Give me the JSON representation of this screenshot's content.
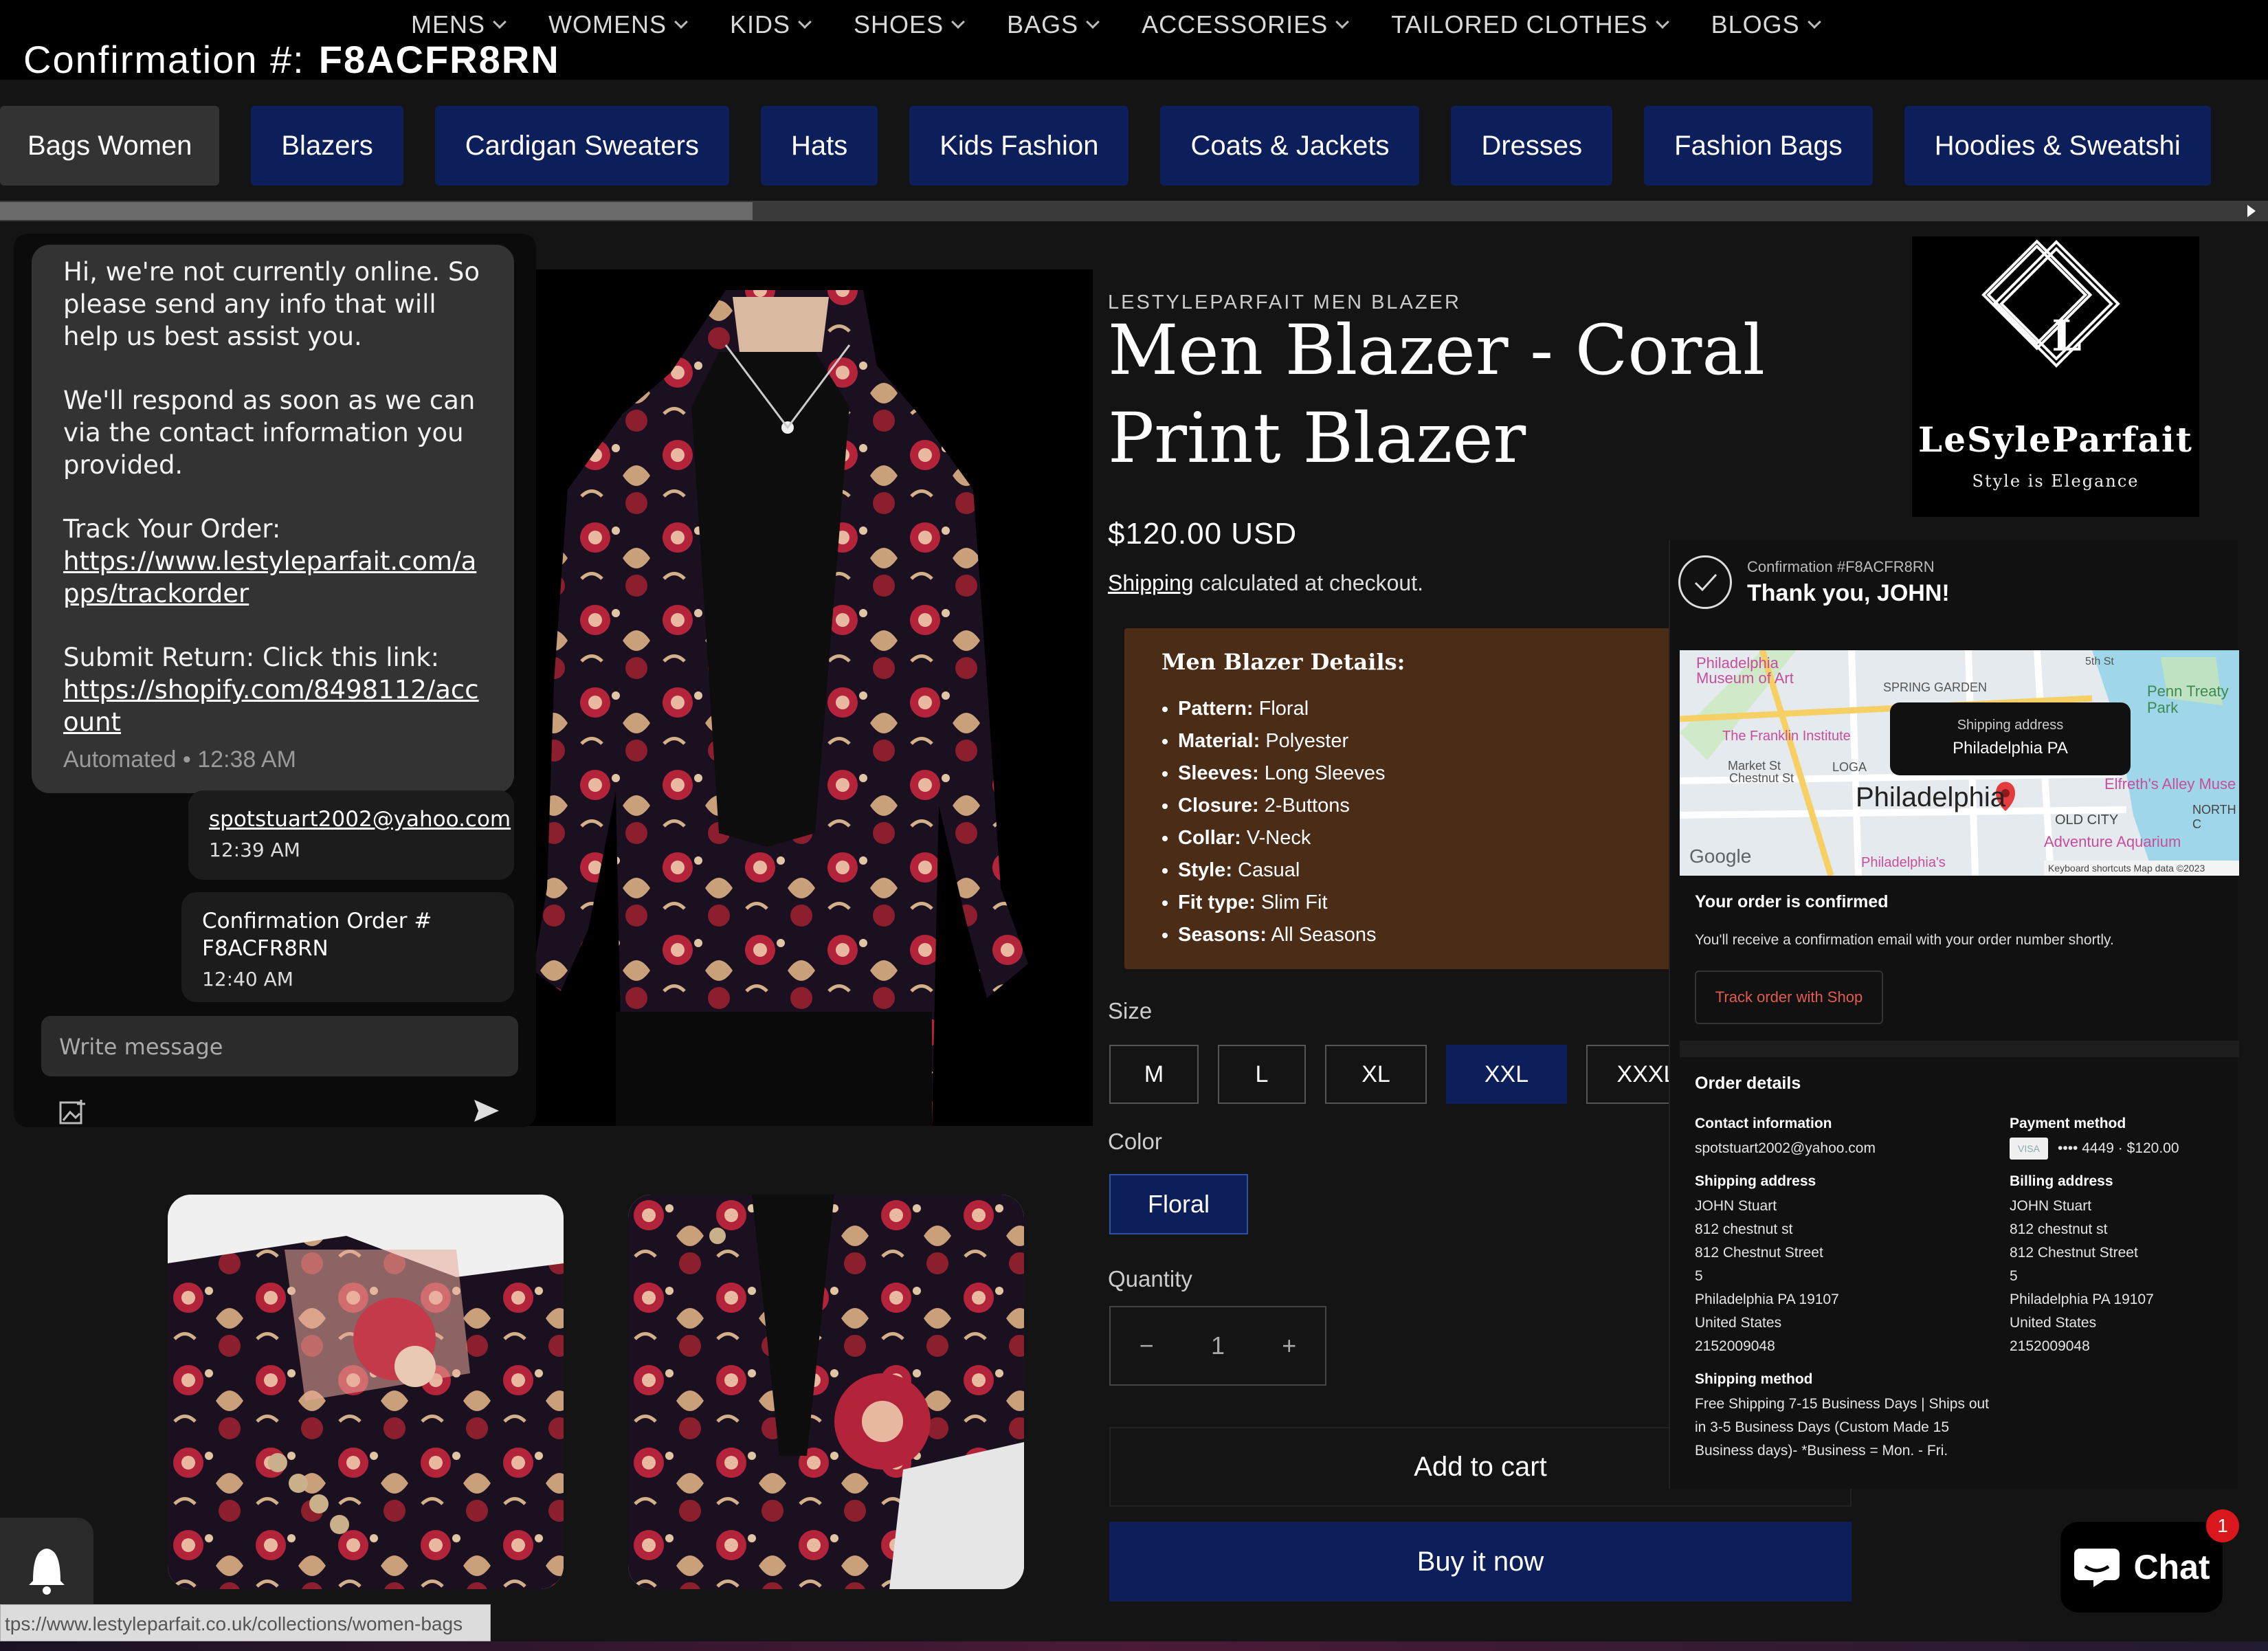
{
  "nav": {
    "items": [
      "MENS",
      "WOMENS",
      "KIDS",
      "SHOES",
      "BAGS",
      "ACCESSORIES",
      "TAILORED CLOTHES",
      "BLOGS"
    ]
  },
  "confirmation_banner": {
    "label": "Confirmation #:",
    "code": "F8ACFR8RN"
  },
  "categories": [
    "Bags Women",
    "Blazers",
    "Cardigan Sweaters",
    "Hats",
    "Kids Fashion",
    "Coats & Jackets",
    "Dresses",
    "Fashion Bags",
    "Hoodies & Sweatshi"
  ],
  "chat": {
    "bot_message": {
      "p1": "Hi, we're not currently online. So please send any info that will help us best assist you.",
      "p2": "We'll respond as soon as we can via the contact information you provided.",
      "p3_label": "Track Your Order:",
      "p3_link": "https://www.lestyleparfait.com/apps/trackorder",
      "p4_label": "Submit Return: Click this link:",
      "p4_link": "https://shopify.com/8498112/account",
      "meta": "Automated • 12:38 AM"
    },
    "user_messages": [
      {
        "text": "spotstuart2002@yahoo.com",
        "time": "12:39 AM"
      },
      {
        "line1": "Confirmation Order #",
        "line2": "F8ACFR8RN",
        "time": "12:40 AM"
      }
    ],
    "input_placeholder": "Write message"
  },
  "product": {
    "vendor": "LESTYLEPARFAIT MEN BLAZER",
    "title": "Men Blazer - Coral Print Blazer",
    "price": "$120.00 USD",
    "shipping_link": "Shipping",
    "shipping_rest": " calculated at checkout.",
    "details_title": "Men Blazer Details:",
    "details": [
      {
        "k": "Pattern:",
        "v": " Floral"
      },
      {
        "k": "Material:",
        "v": " Polyester"
      },
      {
        "k": "Sleeves:",
        "v": " Long Sleeves"
      },
      {
        "k": "Closure:",
        "v": " 2-Buttons"
      },
      {
        "k": "Collar:",
        "v": " V-Neck"
      },
      {
        "k": "Style:",
        "v": " Casual"
      },
      {
        "k": "Fit type:",
        "v": " Slim Fit"
      },
      {
        "k": "Seasons:",
        "v": " All Seasons"
      }
    ],
    "size_label": "Size",
    "sizes": [
      "M",
      "L",
      "XL",
      "XXL",
      "XXXL"
    ],
    "selected_size": "XXL",
    "color_label": "Color",
    "color": "Floral",
    "quantity_label": "Quantity",
    "quantity": "1",
    "minus": "−",
    "plus": "+",
    "add_to_cart": "Add to cart",
    "buy_now": "Buy it now"
  },
  "logo": {
    "name": "LeSyleParfait",
    "tagline": "Style is Elegance",
    "letter": "L"
  },
  "order": {
    "conf_label": "Confirmation #F8ACFR8RN",
    "thanks": "Thank you, JOHN!",
    "map": {
      "shipping_address_label": "Shipping address",
      "city": "Philadelphia PA",
      "labels": [
        "Philadelphia Museum of Art",
        "SPRING GARDEN",
        "The Franklin Institute",
        "Market St",
        "Chestnut St",
        "Philadelphia",
        "OLD CITY",
        "Penn Treaty Park",
        "Elfreth's Alley Muse",
        "Adventure Aquarium",
        "NORTH C",
        "5th St",
        "Google",
        "Keyboard shortcuts",
        "Map data ©2023",
        "LOGA",
        "Philadelphia's"
      ]
    },
    "confirmed_title": "Your order is confirmed",
    "confirmed_msg": "You'll receive a confirmation email with your order number shortly.",
    "track_btn": "Track order with Shop",
    "details_title": "Order details",
    "contact_label": "Contact information",
    "contact": "spotstuart2002@yahoo.com",
    "shipping_label": "Shipping address",
    "shipping_lines": [
      "JOHN Stuart",
      "812 chestnut st",
      "812 Chestnut Street",
      "5",
      "Philadelphia PA 19107",
      "United States",
      "2152009048"
    ],
    "method_label": "Shipping method",
    "method": "Free Shipping 7-15 Business Days | Ships out in 3-5 Business Days (Custom Made 15 Business days)- *Business = Mon. - Fri.",
    "payment_label": "Payment method",
    "payment": "•••• 4449 · $120.00",
    "visa": "VISA",
    "billing_label": "Billing address",
    "billing_lines": [
      "JOHN Stuart",
      "812 chestnut st",
      "812 Chestnut Street",
      "5",
      "Philadelphia PA 19107",
      "United States",
      "2152009048"
    ]
  },
  "chat_widget": {
    "label": "Chat",
    "badge": "1"
  },
  "status_url": "tps://www.lestyleparfait.co.uk/collections/women-bags",
  "colors": {
    "navy": "#0c1f5a",
    "details_bg": "#4a2c17",
    "accent_red": "#e35b4f"
  }
}
